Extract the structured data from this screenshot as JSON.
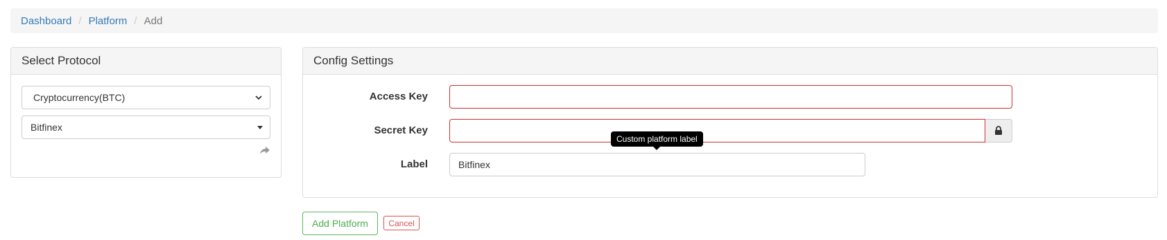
{
  "breadcrumb": {
    "items": [
      "Dashboard",
      "Platform"
    ],
    "active": "Add",
    "separator": "/"
  },
  "left_panel": {
    "title": "Select Protocol",
    "protocol_select": {
      "value": "Cryptocurrency(BTC)",
      "icon": "chevron-down-icon"
    },
    "platform_select": {
      "value": "Bitfinex",
      "icon": "caret-down-icon"
    },
    "share_icon": "share-arrow-icon"
  },
  "config": {
    "title": "Config Settings",
    "access_key": {
      "label": "Access Key",
      "value": ""
    },
    "secret_key": {
      "label": "Secret Key",
      "value": "",
      "addon_icon": "lock-icon"
    },
    "label": {
      "label": "Label",
      "value": "Bitfinex"
    },
    "tooltip": "Custom platform label"
  },
  "actions": {
    "add_label": "Add Platform",
    "cancel_label": "Cancel"
  },
  "colors": {
    "link": "#337ab7",
    "error_border": "#c9302c",
    "success": "#5cb85c",
    "danger": "#d9534f"
  }
}
